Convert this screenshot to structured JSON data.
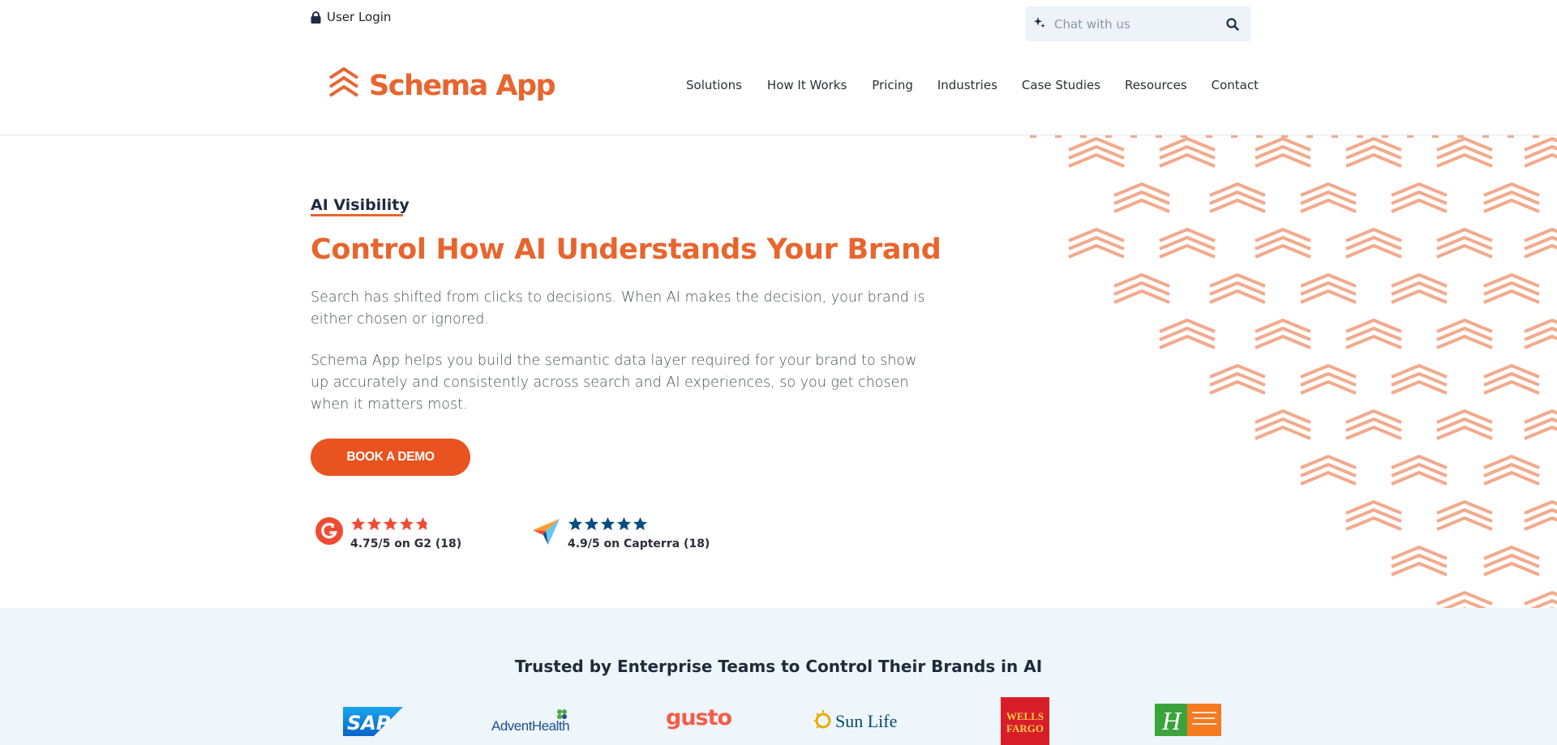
{
  "utility": {
    "login_label": "User Login",
    "chat_placeholder": "Chat with us"
  },
  "brand": {
    "name": "Schema App",
    "accent": "#e8652d",
    "cta_color": "#e8531f"
  },
  "nav": {
    "items": [
      "Solutions",
      "How It Works",
      "Pricing",
      "Industries",
      "Case Studies",
      "Resources",
      "Contact"
    ]
  },
  "hero": {
    "eyebrow": "AI Visibility",
    "title": "Control How AI Understands Your Brand",
    "paragraph1": "Search has shifted from clicks to decisions. When AI makes the decision, your brand is either chosen or ignored.",
    "paragraph2": "Schema App helps you build the semantic data layer required for your brand to show up accurately and consistently across search and AI experiences, so you get chosen when it matters most.",
    "cta_label": "BOOK A DEMO"
  },
  "ratings": [
    {
      "source": "G2",
      "score": 4.75,
      "stars": 4.75,
      "text": "4.75/5 on G2 (18)",
      "icon": "g2-logo-icon"
    },
    {
      "source": "Capterra",
      "score": 4.9,
      "stars": 5,
      "text": "4.9/5 on Capterra (18)",
      "icon": "capterra-logo-icon"
    }
  ],
  "trusted": {
    "title": "Trusted by Enterprise Teams to Control Their Brands in AI",
    "logos": [
      "SAP",
      "AdventHealth",
      "gusto",
      "Sun Life",
      "WELLS FARGO",
      "Holiday Inn Club Vacations"
    ]
  },
  "logo_texts": {
    "sap": "SAP",
    "advent": "AdventHealth",
    "gusto": "gusto",
    "sunlife": "Sun Life",
    "wells1": "WELLS",
    "wells2": "FARGO"
  },
  "icons": {
    "lock": "lock-icon",
    "sparkle": "sparkle-icon",
    "search": "search-icon",
    "logo_mark": "chevron-stack-logo-icon"
  }
}
